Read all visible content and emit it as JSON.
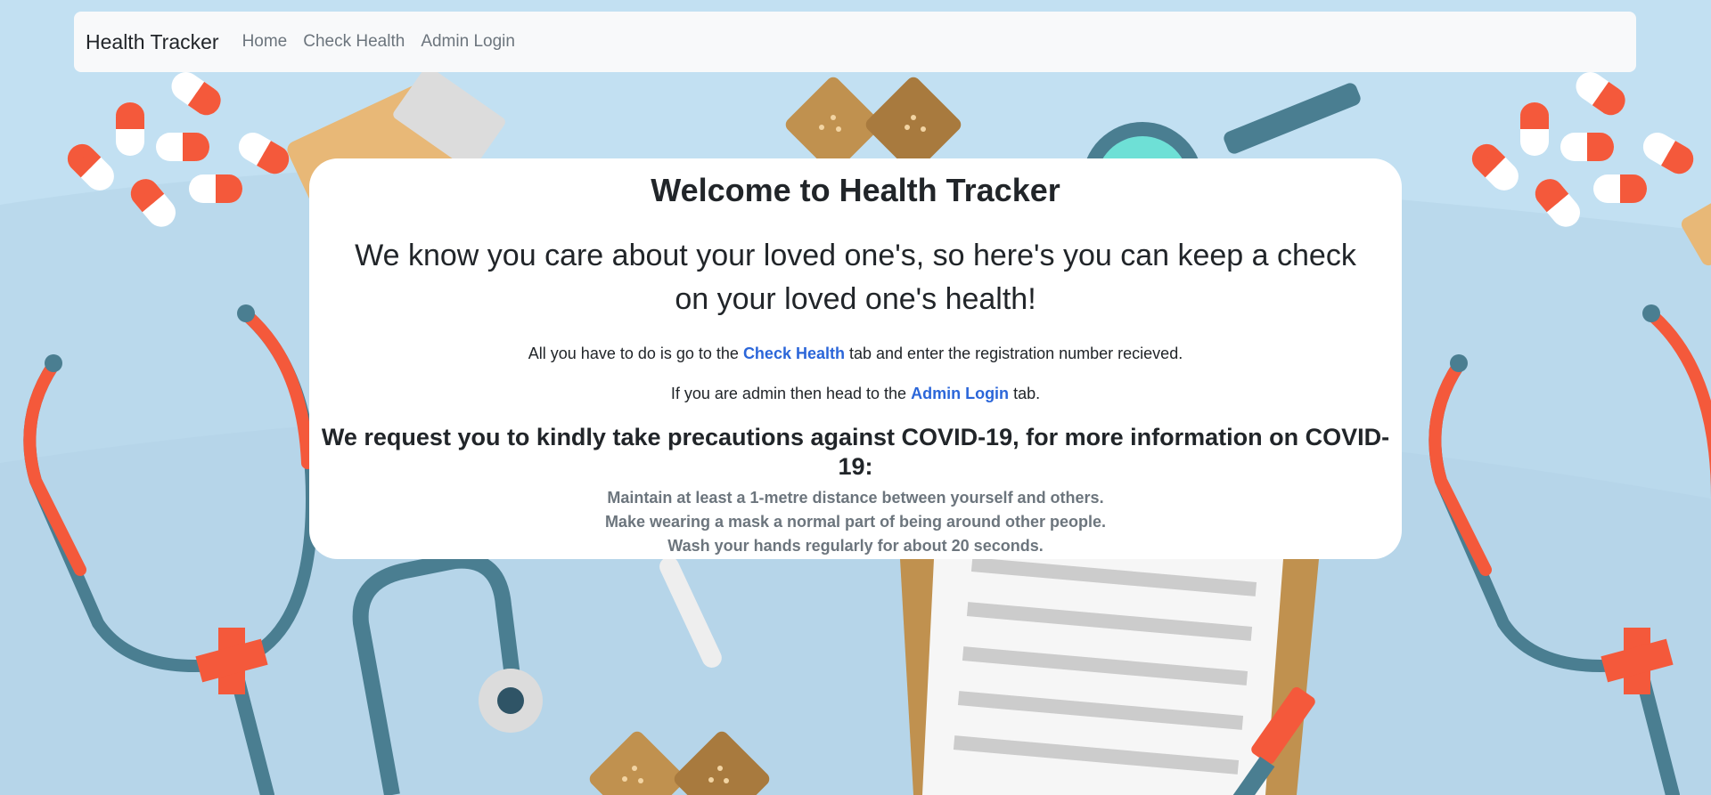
{
  "navbar": {
    "brand": "Health Tracker",
    "links": [
      "Home",
      "Check Health",
      "Admin Login"
    ]
  },
  "welcome": {
    "title": "Welcome to Health Tracker",
    "subtitle": "We know you care about your loved one's, so here's you can keep a check on your loved one's health!",
    "check_line": {
      "before": "All you have to do is go to the ",
      "link": "Check Health",
      "after": " tab and enter the registration number recieved."
    },
    "admin_line": {
      "before": "If you are admin then head to the ",
      "link": "Admin Login",
      "after": " tab."
    },
    "covid_heading": "We request you to kindly take precautions against COVID-19, for more information on COVID-19:",
    "precautions": [
      "Maintain at least a 1-metre distance between yourself and others.",
      "Make wearing a mask a normal part of being around other people.",
      "Wash your hands regularly for about 20 seconds."
    ]
  },
  "colors": {
    "background": "#c2e0f2",
    "link_accent": "#2b66d9",
    "pill_red": "#f4593b",
    "stethoscope": "#4a7e91",
    "bandage": "#c0914f"
  }
}
